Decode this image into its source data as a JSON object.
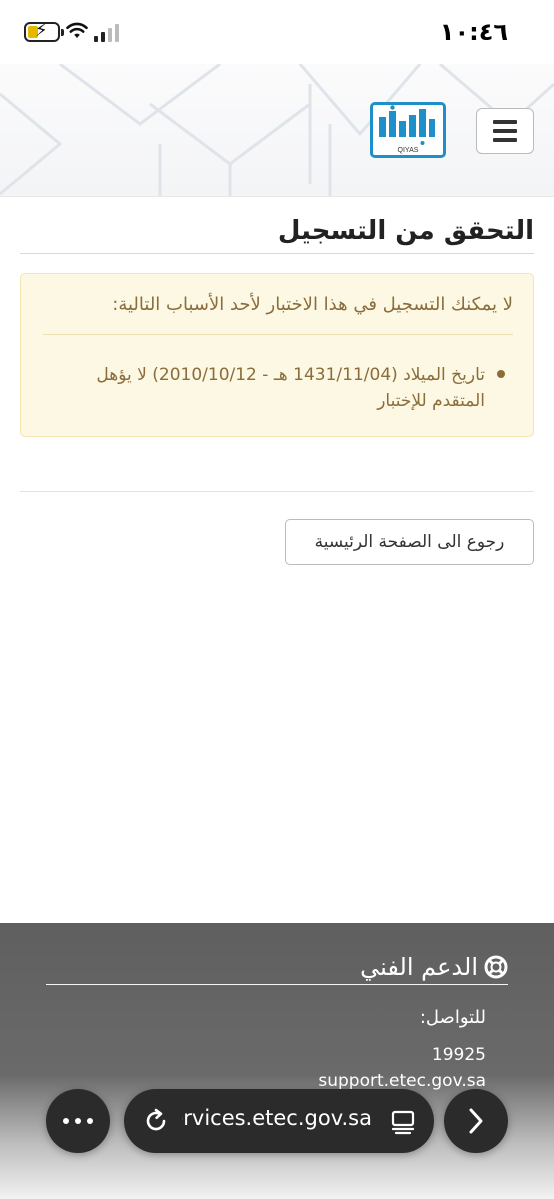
{
  "status_bar": {
    "time": "١٠:٤٦",
    "icons": [
      "battery-charging-icon",
      "wifi-icon",
      "signal-icon"
    ]
  },
  "header": {
    "logo_text": "قياس",
    "logo_subtext": "QIYAS",
    "menu_icon": "hamburger-icon",
    "brand_color": "#1f8fc9"
  },
  "main": {
    "title": "التحقق من التسجيل",
    "alert": {
      "heading": "لا يمكنك التسجيل في هذا الاختبار لأحد الأسباب التالية:",
      "items": [
        "تاريخ الميلاد (1431/11/04 هـ - 2010/10/12) لا يؤهل المتقدم للإختبار"
      ],
      "bg_color": "#fcf8e3",
      "text_color": "#8a6d3b"
    },
    "home_button_label": "رجوع الى الصفحة الرئيسية"
  },
  "footer": {
    "support_title": "الدعم الفني",
    "support_icon": "lifebuoy-icon",
    "contact_label": "للتواصل:",
    "phone": "19925",
    "site": "support.etec.gov.sa"
  },
  "browser": {
    "url": "services.etec.gov.sa",
    "more_icon": "more-dots-icon",
    "reload_icon": "reload-icon",
    "reader_icon": "reader-view-icon",
    "forward_icon": "chevron-right-icon"
  }
}
